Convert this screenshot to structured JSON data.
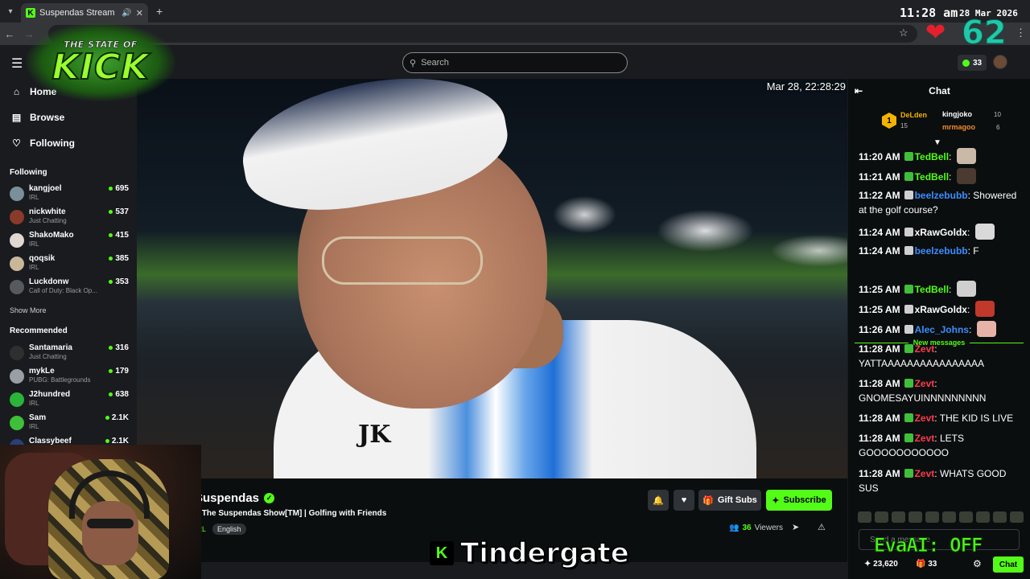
{
  "browser": {
    "tab_title": "Suspendas Stream - Watch",
    "clock": "11:28 am",
    "date": "28 Mar 2026"
  },
  "overlay": {
    "logo_top": "THE STATE OF",
    "logo_main": "KICK",
    "counter": "62",
    "tindergate": "Tindergate",
    "tindergate_k": "K",
    "evaai": "EvaAI: OFF"
  },
  "topnav": {
    "search_placeholder": "Search",
    "kick_points": "33"
  },
  "sidebar": {
    "links": [
      {
        "label": "Home",
        "icon": "home-icon"
      },
      {
        "label": "Browse",
        "icon": "browse-icon"
      },
      {
        "label": "Following",
        "icon": "heart-icon"
      }
    ],
    "following_heading": "Following",
    "following": [
      {
        "name": "kangjoel",
        "category": "IRL",
        "viewers": "695",
        "color": "#7a8f9a"
      },
      {
        "name": "nickwhite",
        "category": "Just Chatting",
        "viewers": "537",
        "color": "#8a3a2a"
      },
      {
        "name": "ShakoMako",
        "category": "IRL",
        "viewers": "415",
        "color": "#e0d8d0"
      },
      {
        "name": "qoqsik",
        "category": "IRL",
        "viewers": "385",
        "color": "#c9b79a"
      },
      {
        "name": "Luckdonw",
        "category": "Call of Duty: Black Op...",
        "viewers": "353",
        "color": "#555a5f"
      }
    ],
    "show_more": "Show More",
    "recommended_heading": "Recommended",
    "recommended": [
      {
        "name": "Santamaria",
        "category": "Just Chatting",
        "viewers": "316",
        "color": "#2f2f2f"
      },
      {
        "name": "mykLe",
        "category": "PUBG: Battlegrounds",
        "viewers": "179",
        "color": "#9a9fa5"
      },
      {
        "name": "J2hundred",
        "category": "IRL",
        "viewers": "638",
        "color": "#2bb33a"
      },
      {
        "name": "Sam",
        "category": "IRL",
        "viewers": "2.1K",
        "color": "#3fbf3a"
      },
      {
        "name": "Classybeef",
        "category": "Slots & Casino",
        "viewers": "2.1K",
        "color": "#2a3f7a"
      }
    ]
  },
  "video": {
    "timestamp": "Mar 28, 22:28:29"
  },
  "stream": {
    "streamer": "Suspendas",
    "avatar_text": "sus",
    "title": "The Suspendas Show[TM] | Golfing with Friends",
    "category": "IRL",
    "language": "English",
    "viewers": "36",
    "viewers_label": "Viewers",
    "gift_label": "Gift Subs",
    "subscribe_label": "Subscribe"
  },
  "chat": {
    "header": "Chat",
    "leaderboard": [
      {
        "name": "DeLden",
        "count": "15",
        "color": "#f3b300"
      },
      {
        "name": "kingjoko",
        "count": "10",
        "color": "#ffffff"
      },
      {
        "name": "mrmagoo",
        "count": "6",
        "color": "#f08a2a"
      }
    ],
    "rank_badge": "1",
    "messages": [
      {
        "time": "11:20 AM",
        "user": "TedBell",
        "color": "#53fc18",
        "text": ""
      },
      {
        "time": "11:21 AM",
        "user": "TedBell",
        "color": "#53fc18",
        "text": ""
      },
      {
        "time": "11:22 AM",
        "user": "beelzebubb",
        "color": "#3c8dff",
        "text": "Showered at the golf course?"
      },
      {
        "time": "11:24 AM",
        "user": "xRawGoldx",
        "color": "#ffffff",
        "text": ""
      },
      {
        "time": "11:24 AM",
        "user": "beelzebubb",
        "color": "#3c8dff",
        "text": "F"
      },
      {
        "time": "11:25 AM",
        "user": "TedBell",
        "color": "#53fc18",
        "text": ""
      },
      {
        "time": "11:25 AM",
        "user": "xRawGoldx",
        "color": "#ffffff",
        "text": ""
      },
      {
        "time": "11:26 AM",
        "user": "Alec_Johns",
        "color": "#3c8dff",
        "text": ""
      },
      {
        "time": "11:28 AM",
        "user": "Zevt",
        "color": "#ff3a4a",
        "text": "YATTAAAAAAAAAAAAAAAA"
      },
      {
        "time": "11:28 AM",
        "user": "Zevt",
        "color": "#ff3a4a",
        "text": "GNOMESAYUINNNNNNNNN"
      },
      {
        "time": "11:28 AM",
        "user": "Zevt",
        "color": "#ff3a4a",
        "text": "THE KID IS LIVE"
      },
      {
        "time": "11:28 AM",
        "user": "Zevt",
        "color": "#ff3a4a",
        "text": "LETS GOOOOOOOOOOO"
      },
      {
        "time": "11:28 AM",
        "user": "Zevt",
        "color": "#ff3a4a",
        "text": "WHATS GOOD SUS"
      }
    ],
    "new_messages": "New messages",
    "input_placeholder": "Send a message",
    "points": "23,620",
    "gifts": "33",
    "chat_button": "Chat"
  }
}
